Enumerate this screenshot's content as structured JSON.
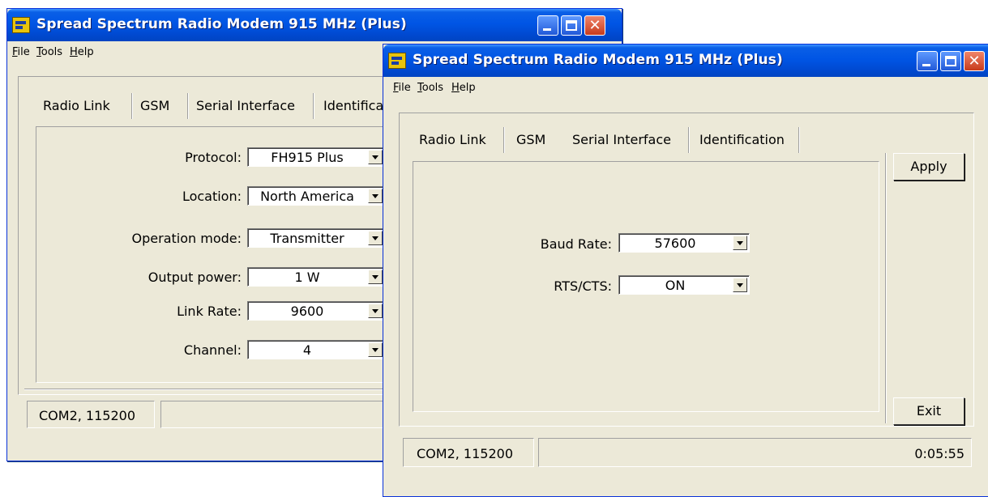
{
  "back_window": {
    "title": "Spread Spectrum Radio Modem 915 MHz (Plus)",
    "menu": [
      {
        "label": "File"
      },
      {
        "label": "Tools"
      },
      {
        "label": "Help"
      }
    ],
    "tabs": [
      {
        "label": "Radio Link",
        "active": true
      },
      {
        "label": "GSM"
      },
      {
        "label": "Serial Interface"
      },
      {
        "label": "Identification"
      }
    ],
    "fields": [
      {
        "label": "Protocol:",
        "value": "FH915 Plus"
      },
      {
        "label": "Location:",
        "value": "North America"
      },
      {
        "label": "Operation mode:",
        "value": "Transmitter"
      },
      {
        "label": "Output power:",
        "value": "1 W"
      },
      {
        "label": "Link Rate:",
        "value": "9600"
      },
      {
        "label": "Channel:",
        "value": "4"
      }
    ],
    "status": {
      "port": "COM2, 115200"
    }
  },
  "front_window": {
    "title": "Spread Spectrum Radio Modem 915 MHz (Plus)",
    "menu": [
      {
        "label": "File"
      },
      {
        "label": "Tools"
      },
      {
        "label": "Help"
      }
    ],
    "tabs": [
      {
        "label": "Radio Link"
      },
      {
        "label": "GSM"
      },
      {
        "label": "Serial Interface",
        "active": true
      },
      {
        "label": "Identification"
      }
    ],
    "fields": [
      {
        "label": "Baud Rate:",
        "value": "57600"
      },
      {
        "label": "RTS/CTS:",
        "value": "ON"
      }
    ],
    "buttons": {
      "apply": "Apply",
      "exit": "Exit"
    },
    "status": {
      "port": "COM2, 115200",
      "time": "0:05:55"
    }
  },
  "colors": {
    "title_bar": "#0055e5",
    "window_face": "#ece9d8",
    "close_button": "#d9532f",
    "desktop": "#ffffff"
  },
  "icons": [
    "app-icon",
    "minimize-icon",
    "maximize-icon",
    "close-icon",
    "dropdown-arrow-icon"
  ]
}
